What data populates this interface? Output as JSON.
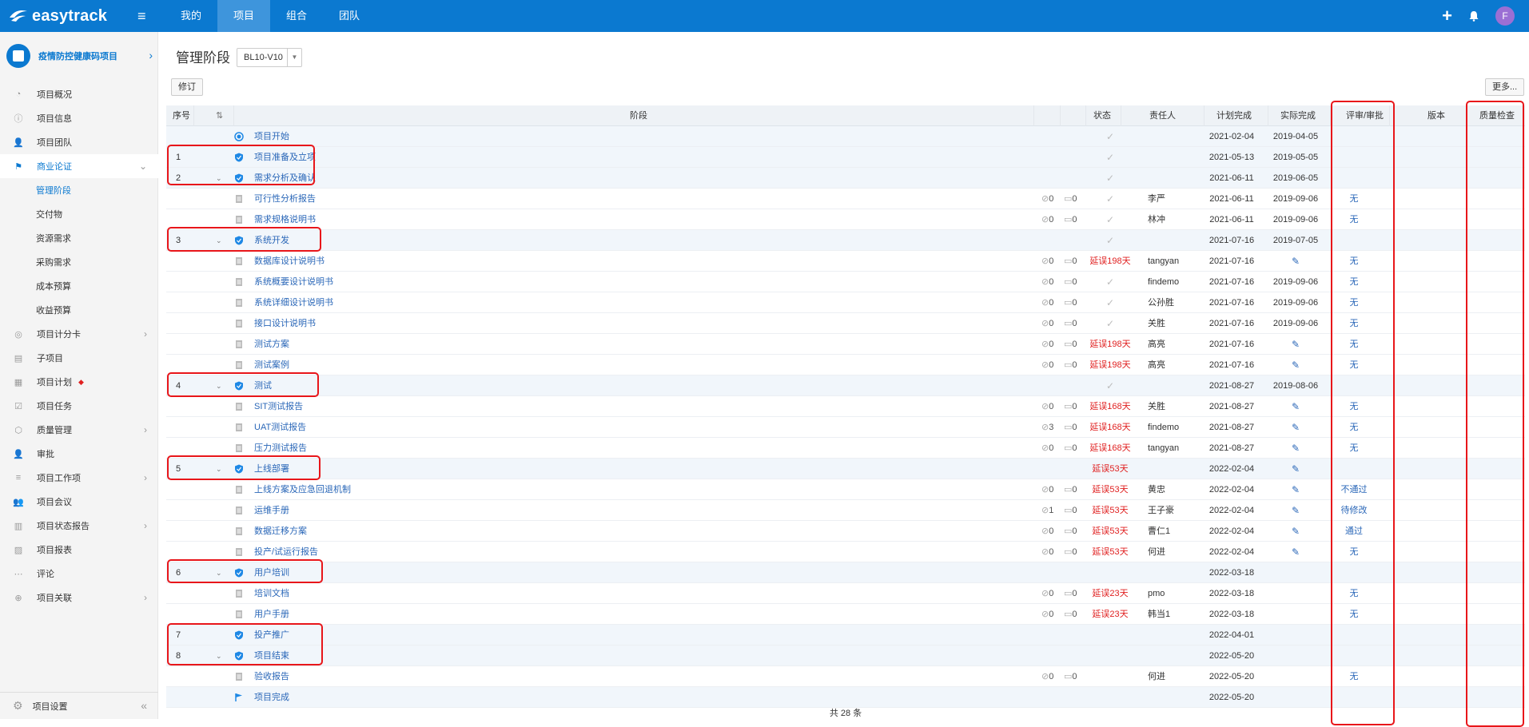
{
  "app": {
    "logo_text": "easytrack",
    "user_initial": "F"
  },
  "topnav": [
    "我的",
    "项目",
    "组合",
    "团队"
  ],
  "project": {
    "name": "疫情防控健康码项目"
  },
  "menu": [
    {
      "label": "项目概况",
      "icon": "pie-chart-icon"
    },
    {
      "label": "项目信息",
      "icon": "info-icon"
    },
    {
      "label": "项目团队",
      "icon": "team-icon"
    },
    {
      "label": "商业论证",
      "icon": "flag-icon",
      "expanded": true
    },
    {
      "label": "管理阶段",
      "sub": true
    },
    {
      "label": "交付物",
      "sub": true
    },
    {
      "label": "资源需求",
      "sub": true
    },
    {
      "label": "采购需求",
      "sub": true
    },
    {
      "label": "成本预算",
      "sub": true
    },
    {
      "label": "收益预算",
      "sub": true
    },
    {
      "label": "项目计分卡",
      "icon": "scorecard-icon",
      "chev": true
    },
    {
      "label": "子项目",
      "icon": "subproject-icon"
    },
    {
      "label": "项目计划",
      "icon": "plan-icon",
      "dot": true
    },
    {
      "label": "项目任务",
      "icon": "task-icon"
    },
    {
      "label": "质量管理",
      "icon": "quality-icon",
      "chev": true
    },
    {
      "label": "审批",
      "icon": "approve-icon"
    },
    {
      "label": "项目工作项",
      "icon": "workitem-icon",
      "chev": true
    },
    {
      "label": "项目会议",
      "icon": "meeting-icon"
    },
    {
      "label": "项目状态报告",
      "icon": "report-icon",
      "chev": true
    },
    {
      "label": "项目报表",
      "icon": "chart-icon"
    },
    {
      "label": "评论",
      "icon": "comment-icon"
    },
    {
      "label": "项目关联",
      "icon": "link-icon",
      "chev": true
    }
  ],
  "sidebar_footer": "项目设置",
  "page": {
    "title": "管理阶段",
    "version": "BL10-V10",
    "revise_btn": "修订",
    "more_btn": "更多..."
  },
  "columns": {
    "seq": "序号",
    "stage": "阶段",
    "status": "状态",
    "owner": "责任人",
    "plan": "计划完成",
    "actual": "实际完成",
    "review": "评审/审批",
    "version": "版本",
    "quality": "质量检查"
  },
  "rows": [
    {
      "type": "start",
      "name": "项目开始",
      "status": "check",
      "plan": "2021-02-04",
      "actual": "2019-04-05"
    },
    {
      "type": "stage",
      "seq": "1",
      "name": "项目准备及立项",
      "status": "check",
      "plan": "2021-05-13",
      "actual": "2019-05-05"
    },
    {
      "type": "stage",
      "seq": "2",
      "expand": true,
      "name": "需求分析及确认",
      "status": "check",
      "plan": "2021-06-11",
      "actual": "2019-06-05"
    },
    {
      "type": "doc",
      "name": "可行性分析报告",
      "a1": "0",
      "a2": "0",
      "status": "check",
      "owner": "李严",
      "plan": "2021-06-11",
      "actual": "2019-09-06",
      "review": "无"
    },
    {
      "type": "doc",
      "name": "需求规格说明书",
      "a1": "0",
      "a2": "0",
      "status": "check",
      "owner": "林冲",
      "plan": "2021-06-11",
      "actual": "2019-09-06",
      "review": "无"
    },
    {
      "type": "stage",
      "seq": "3",
      "expand": true,
      "name": "系统开发",
      "status": "check",
      "plan": "2021-07-16",
      "actual": "2019-07-05"
    },
    {
      "type": "doc",
      "name": "数据库设计说明书",
      "a1": "0",
      "a2": "0",
      "status": "延误198天",
      "owner": "tangyan",
      "plan": "2021-07-16",
      "actual": "edit",
      "review": "无"
    },
    {
      "type": "doc",
      "name": "系统概要设计说明书",
      "a1": "0",
      "a2": "0",
      "status": "check",
      "owner": "findemo",
      "plan": "2021-07-16",
      "actual": "2019-09-06",
      "review": "无"
    },
    {
      "type": "doc",
      "name": "系统详细设计说明书",
      "a1": "0",
      "a2": "0",
      "status": "check",
      "owner": "公孙胜",
      "plan": "2021-07-16",
      "actual": "2019-09-06",
      "review": "无"
    },
    {
      "type": "doc",
      "name": "接口设计说明书",
      "a1": "0",
      "a2": "0",
      "status": "check",
      "owner": "关胜",
      "plan": "2021-07-16",
      "actual": "2019-09-06",
      "review": "无"
    },
    {
      "type": "doc",
      "name": "测试方案",
      "a1": "0",
      "a2": "0",
      "status": "延误198天",
      "owner": "高亮",
      "plan": "2021-07-16",
      "actual": "edit",
      "review": "无"
    },
    {
      "type": "doc",
      "name": "测试案例",
      "a1": "0",
      "a2": "0",
      "status": "延误198天",
      "owner": "高亮",
      "plan": "2021-07-16",
      "actual": "edit",
      "review": "无"
    },
    {
      "type": "stage",
      "seq": "4",
      "expand": true,
      "name": "测试",
      "status": "check",
      "plan": "2021-08-27",
      "actual": "2019-08-06"
    },
    {
      "type": "doc",
      "name": "SIT测试报告",
      "a1": "0",
      "a2": "0",
      "status": "延误168天",
      "owner": "关胜",
      "plan": "2021-08-27",
      "actual": "edit",
      "review": "无"
    },
    {
      "type": "doc",
      "name": "UAT测试报告",
      "a1": "3",
      "a2": "0",
      "status": "延误168天",
      "owner": "findemo",
      "plan": "2021-08-27",
      "actual": "edit",
      "review": "无"
    },
    {
      "type": "doc",
      "name": "压力测试报告",
      "a1": "0",
      "a2": "0",
      "status": "延误168天",
      "owner": "tangyan",
      "plan": "2021-08-27",
      "actual": "edit",
      "review": "无"
    },
    {
      "type": "stage",
      "seq": "5",
      "expand": true,
      "name": "上线部署",
      "status": "延误53天",
      "plan": "2022-02-04",
      "actual": "edit"
    },
    {
      "type": "doc",
      "name": "上线方案及应急回退机制",
      "a1": "0",
      "a2": "0",
      "status": "延误53天",
      "owner": "黄忠",
      "plan": "2022-02-04",
      "actual": "edit",
      "review": "不通过"
    },
    {
      "type": "doc",
      "name": "运维手册",
      "a1": "1",
      "a2": "0",
      "status": "延误53天",
      "owner": "王子豪",
      "plan": "2022-02-04",
      "actual": "edit",
      "review": "待修改"
    },
    {
      "type": "doc",
      "name": "数据迁移方案",
      "a1": "0",
      "a2": "0",
      "status": "延误53天",
      "owner": "曹仁1",
      "plan": "2022-02-04",
      "actual": "edit",
      "review": "通过"
    },
    {
      "type": "doc",
      "name": "投产/试运行报告",
      "a1": "0",
      "a2": "0",
      "status": "延误53天",
      "owner": "何进",
      "plan": "2022-02-04",
      "actual": "edit",
      "review": "无"
    },
    {
      "type": "stage",
      "seq": "6",
      "expand": true,
      "name": "用户培训",
      "plan": "2022-03-18"
    },
    {
      "type": "doc",
      "name": "培训文档",
      "a1": "0",
      "a2": "0",
      "status": "延误23天",
      "owner": "pmo",
      "plan": "2022-03-18",
      "review": "无"
    },
    {
      "type": "doc",
      "name": "用户手册",
      "a1": "0",
      "a2": "0",
      "status": "延误23天",
      "owner": "韩当1",
      "plan": "2022-03-18",
      "review": "无"
    },
    {
      "type": "stage",
      "seq": "7",
      "name": "投产推广",
      "plan": "2022-04-01"
    },
    {
      "type": "stage",
      "seq": "8",
      "expand": true,
      "name": "项目结束",
      "plan": "2022-05-20"
    },
    {
      "type": "doc",
      "name": "验收报告",
      "a1": "0",
      "a2": "0",
      "owner": "何进",
      "plan": "2022-05-20",
      "review": "无"
    },
    {
      "type": "finish",
      "name": "项目完成",
      "plan": "2022-05-20"
    }
  ],
  "footer": "共 28 条"
}
